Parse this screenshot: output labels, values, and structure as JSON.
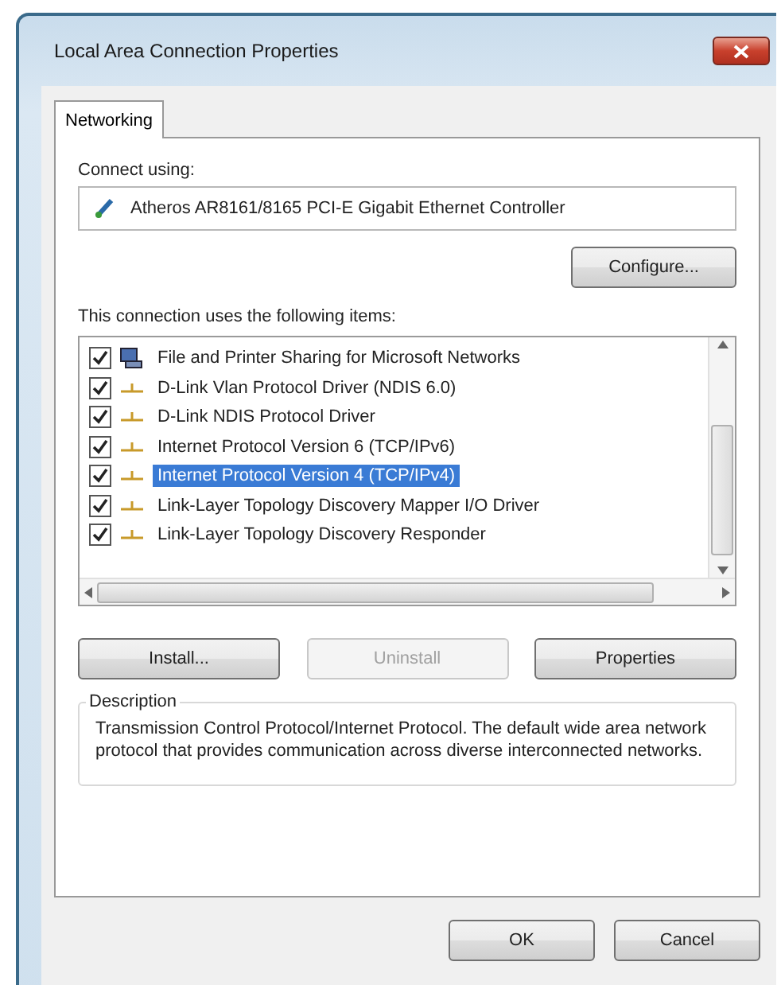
{
  "window": {
    "title": "Local Area Connection  Properties"
  },
  "tabs": [
    {
      "label": "Networking",
      "selected": true
    }
  ],
  "connect_using": {
    "label": "Connect using:",
    "adapter": "Atheros AR8161/8165 PCI-E Gigabit Ethernet Controller",
    "configure_button": "Configure..."
  },
  "items_label": "This connection uses the following items:",
  "items": [
    {
      "kind": "client",
      "label": "File and Printer Sharing for Microsoft Networks",
      "checked": true,
      "selected": false
    },
    {
      "kind": "protocol",
      "label": "D-Link Vlan Protocol Driver (NDIS 6.0)",
      "checked": true,
      "selected": false
    },
    {
      "kind": "protocol",
      "label": "D-Link NDIS Protocol Driver",
      "checked": true,
      "selected": false
    },
    {
      "kind": "protocol",
      "label": "Internet Protocol Version 6 (TCP/IPv6)",
      "checked": true,
      "selected": false
    },
    {
      "kind": "protocol",
      "label": "Internet Protocol Version 4 (TCP/IPv4)",
      "checked": true,
      "selected": true
    },
    {
      "kind": "protocol",
      "label": "Link-Layer Topology Discovery Mapper I/O Driver",
      "checked": true,
      "selected": false
    },
    {
      "kind": "protocol",
      "label": "Link-Layer Topology Discovery Responder",
      "checked": true,
      "selected": false
    }
  ],
  "item_buttons": [
    {
      "label": "Install...",
      "disabled": false
    },
    {
      "label": "Uninstall",
      "disabled": true
    },
    {
      "label": "Properties",
      "disabled": false
    }
  ],
  "description": {
    "title": "Description",
    "text": "Transmission Control Protocol/Internet Protocol. The default wide area network protocol that provides communication across diverse interconnected networks."
  },
  "dialog_buttons": [
    "OK",
    "Cancel"
  ]
}
